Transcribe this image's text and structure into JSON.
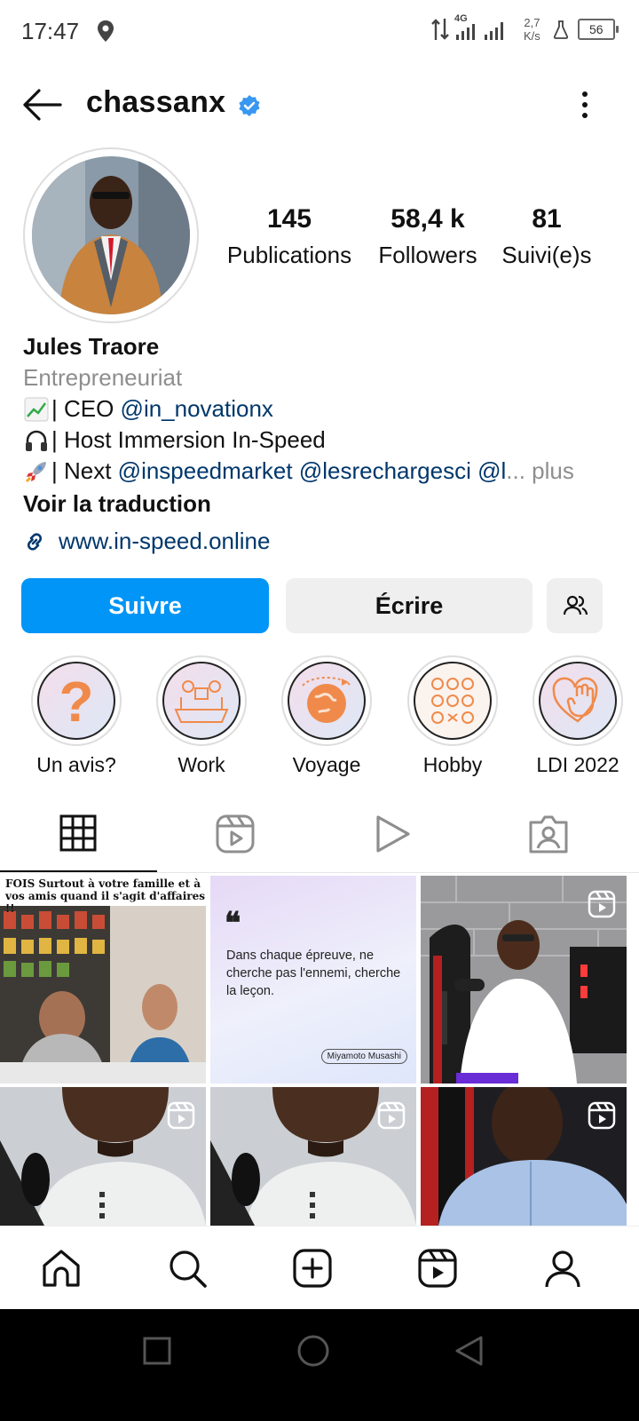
{
  "status_bar": {
    "time": "17:47",
    "network": "4G",
    "speed_value": "2,7",
    "speed_unit": "K/s",
    "battery": "56"
  },
  "header": {
    "username": "chassanx",
    "verified": true
  },
  "profile": {
    "stats": [
      {
        "value": "145",
        "label": "Publications"
      },
      {
        "value": "58,4 k",
        "label": "Followers"
      },
      {
        "value": "81",
        "label": "Suivi(e)s"
      }
    ],
    "name": "Jules Traore",
    "category": "Entrepreneuriat",
    "bio": {
      "line1_text": "| CEO ",
      "line1_mention": "@in_novationx",
      "line2_text": "| Host Immersion In-Speed",
      "line3_text": "| Next ",
      "line3_mentions": "@inspeedmarket @lesrechargesci @l",
      "line3_ellipsis": "...",
      "line3_more": " plus"
    },
    "translate": "Voir la traduction",
    "link": "www.in-speed.online"
  },
  "actions": {
    "follow": "Suivre",
    "message": "Écrire"
  },
  "highlights": [
    {
      "label": "Un avis?"
    },
    {
      "label": "Work"
    },
    {
      "label": "Voyage"
    },
    {
      "label": "Hobby"
    },
    {
      "label": "LDI 2022"
    }
  ],
  "posts": {
    "post1_caption_line1": "FOIS  Surtout à votre famille et à",
    "post1_caption_line2": "vos amis quand il s'agit d'affaires !!",
    "post2_quote_mark": "❝",
    "post2_quote": "Dans chaque épreuve, ne cherche pas l'ennemi, cherche la leçon.",
    "post2_author": "Miyamoto Musashi"
  },
  "colors": {
    "accent": "#0095f6",
    "mention": "#00376b",
    "verified": "#3897f0",
    "highlight_icon": "#f08a4b"
  }
}
